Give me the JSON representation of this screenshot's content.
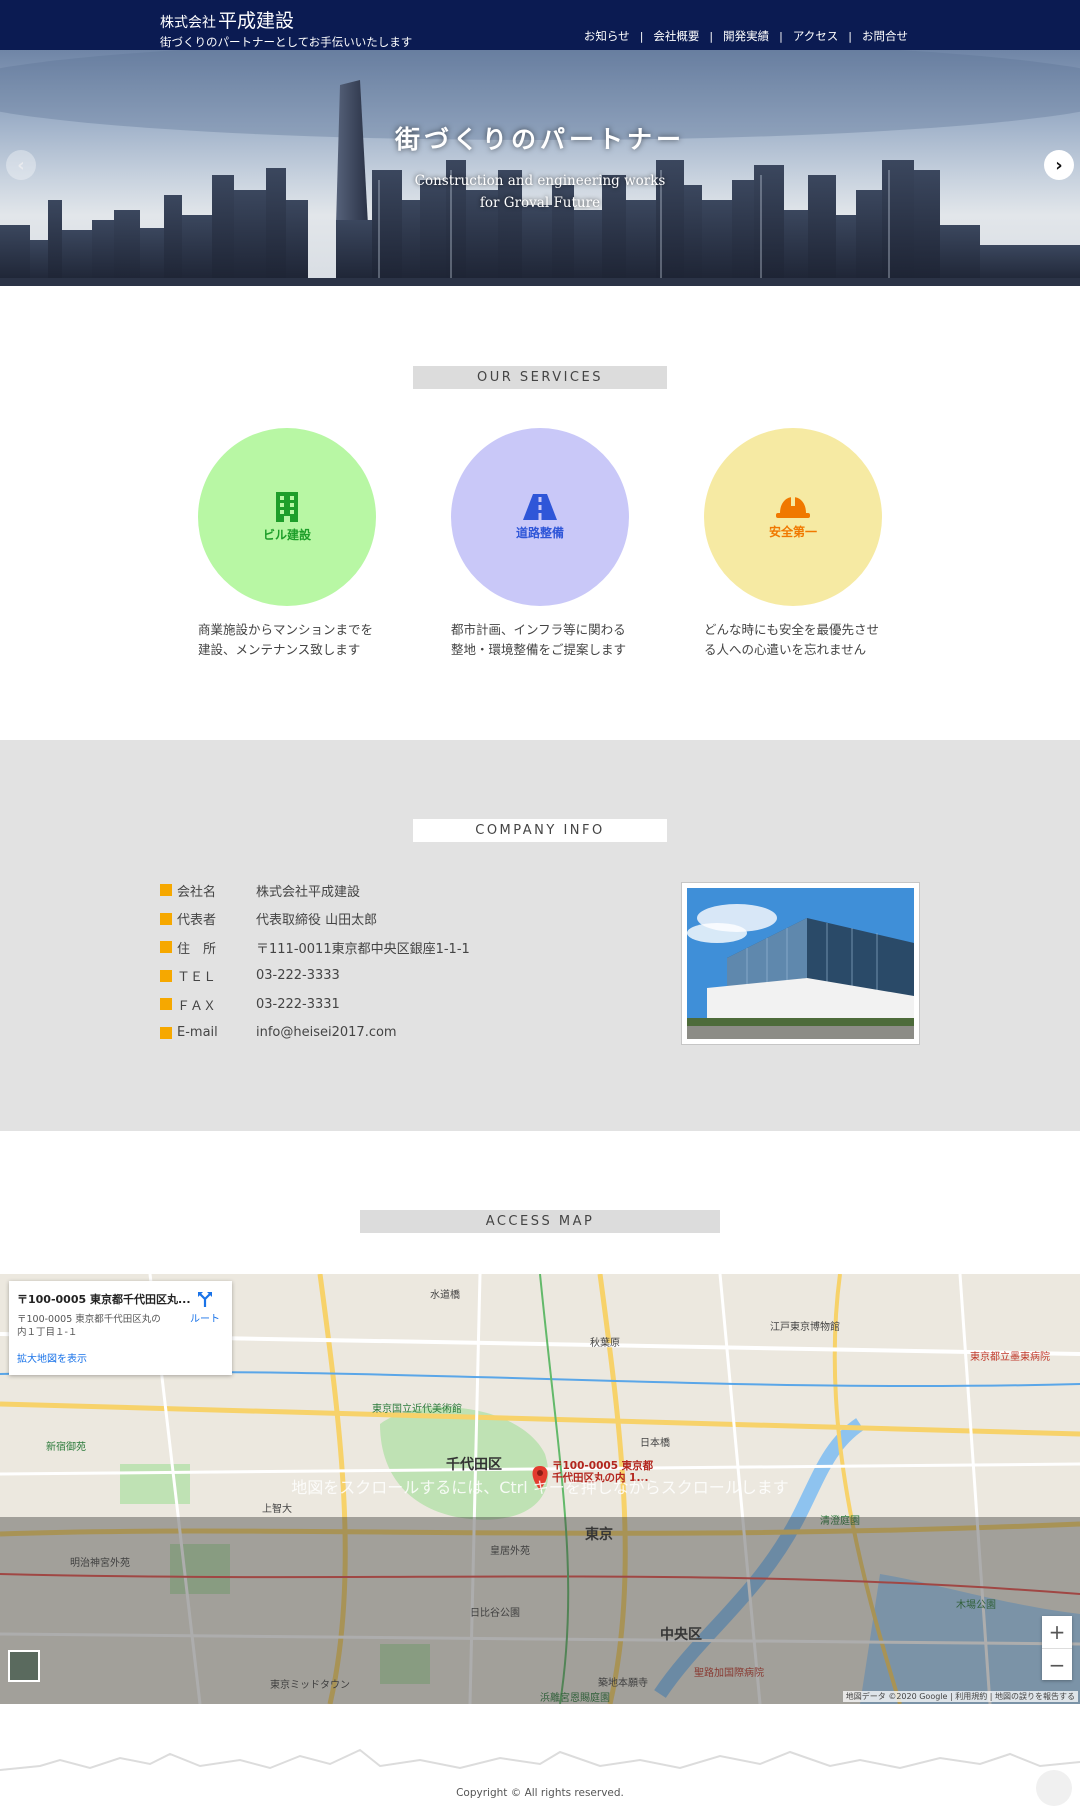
{
  "header": {
    "company_prefix": "株式会社",
    "company_name": "平成建設",
    "tagline": "街づくりのパートナーとしてお手伝いいたします",
    "nav": [
      "お知らせ",
      "会社概要",
      "開発実績",
      "アクセス",
      "お問合せ"
    ],
    "nav_separator": "|",
    "colors": {
      "header_bg": "#0b1b52"
    }
  },
  "hero": {
    "title": "街づくりのパートナー",
    "subtitle_line1": "Construction and engineering works",
    "subtitle_line2": "for Groval Future",
    "prev_icon": "chevron-left-icon",
    "next_icon": "chevron-right-icon"
  },
  "services": {
    "heading": "OUR SERVICES",
    "items": [
      {
        "label": "ビル建設",
        "icon": "building-icon",
        "color": "#b8f7a4",
        "label_color": "#1e9e2a",
        "desc_line1": "商業施設からマンションまでを",
        "desc_line2": "建設、メンテナンス致します"
      },
      {
        "label": "道路整備",
        "icon": "road-icon",
        "color": "#c9c8f8",
        "label_color": "#2f56d8",
        "desc_line1": "都市計画、インフラ等に関わる",
        "desc_line2": "整地・環境整備をご提案します"
      },
      {
        "label": "安全第一",
        "icon": "hardhat-icon",
        "color": "#f6eaa3",
        "label_color": "#f07800",
        "desc_line1": "どんな時にも安全を最優先させ",
        "desc_line2": "る人への心遣いを忘れません"
      }
    ]
  },
  "company_info": {
    "heading": "COMPANY INFO",
    "bullet_color": "#f6a800",
    "rows": [
      {
        "key": "会社名",
        "value": "株式会社平成建設"
      },
      {
        "key": "代表者",
        "value": "代表取締役 山田太郎"
      },
      {
        "key": "住　所",
        "value": "〒111-0011東京都中央区銀座1-1-1"
      },
      {
        "key": "ＴＥＬ",
        "value": "03-222-3333"
      },
      {
        "key": "ＦＡＸ",
        "value": "03-222-3331"
      },
      {
        "key": "E-mail",
        "value": "info@heisei2017.com"
      }
    ]
  },
  "access_map": {
    "heading": "ACCESS MAP",
    "card_title": "〒100-0005 東京都千代田区丸...",
    "card_address": "〒100-0005 東京都千代田区丸の内１丁目１-１",
    "card_bigger_map": "拡大地図を表示",
    "card_route": "ルート",
    "pin_label": "〒100-0005 東京都千代田区丸の内 1...",
    "scroll_hint": "地図をスクロールするには、Ctrl キーを押しながらスクロールします",
    "zoom_in": "+",
    "zoom_out": "−",
    "attribution": "地図データ ©2020 Google | 利用規約 | 地図の誤りを報告する",
    "labels": [
      {
        "text": "千代田区"
      },
      {
        "text": "中央区"
      },
      {
        "text": "東京"
      },
      {
        "text": "東京国立近代美術館"
      },
      {
        "text": "皇居外苑"
      },
      {
        "text": "日比谷公園"
      },
      {
        "text": "東京ミッドタウン"
      },
      {
        "text": "築地本願寺"
      },
      {
        "text": "浜離宮恩賜庭園"
      },
      {
        "text": "江戸東京博物館"
      },
      {
        "text": "明治神宮外苑"
      },
      {
        "text": "新宿御苑"
      },
      {
        "text": "上智大"
      },
      {
        "text": "聖路加国際病院"
      },
      {
        "text": "木場公園"
      },
      {
        "text": "清澄庭園"
      },
      {
        "text": "東京都立墨東病院"
      },
      {
        "text": "日本橋"
      },
      {
        "text": "秋葉原"
      },
      {
        "text": "水道橋"
      }
    ]
  },
  "footer": {
    "copyright": "Copyright © All rights reserved."
  }
}
